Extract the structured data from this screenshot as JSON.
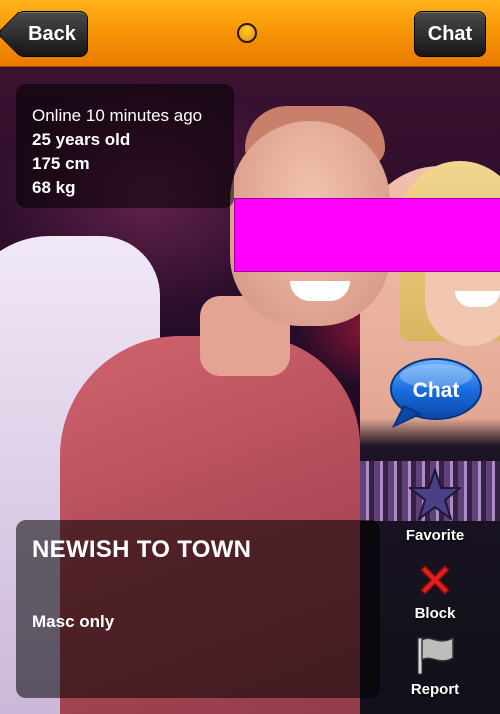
{
  "navbar": {
    "back_label": "Back",
    "chat_label": "Chat"
  },
  "profile": {
    "status": "Online 10 minutes ago",
    "age": "25 years old",
    "height": "175 cm",
    "weight": "68 kg",
    "headline": "NEWISH TO TOWN",
    "description": "Masc only"
  },
  "actions": {
    "chat_label": "Chat",
    "favorite_label": "Favorite",
    "block_label": "Block",
    "report_label": "Report"
  },
  "colors": {
    "navbar": "#f79406",
    "censor_bar": "#ff00ff",
    "chat_bubble": "#1a6fe0",
    "block_x": "#e0201c"
  },
  "icons": [
    "page-indicator-dot",
    "chat-bubble-icon",
    "star-icon",
    "x-icon",
    "flag-icon"
  ]
}
